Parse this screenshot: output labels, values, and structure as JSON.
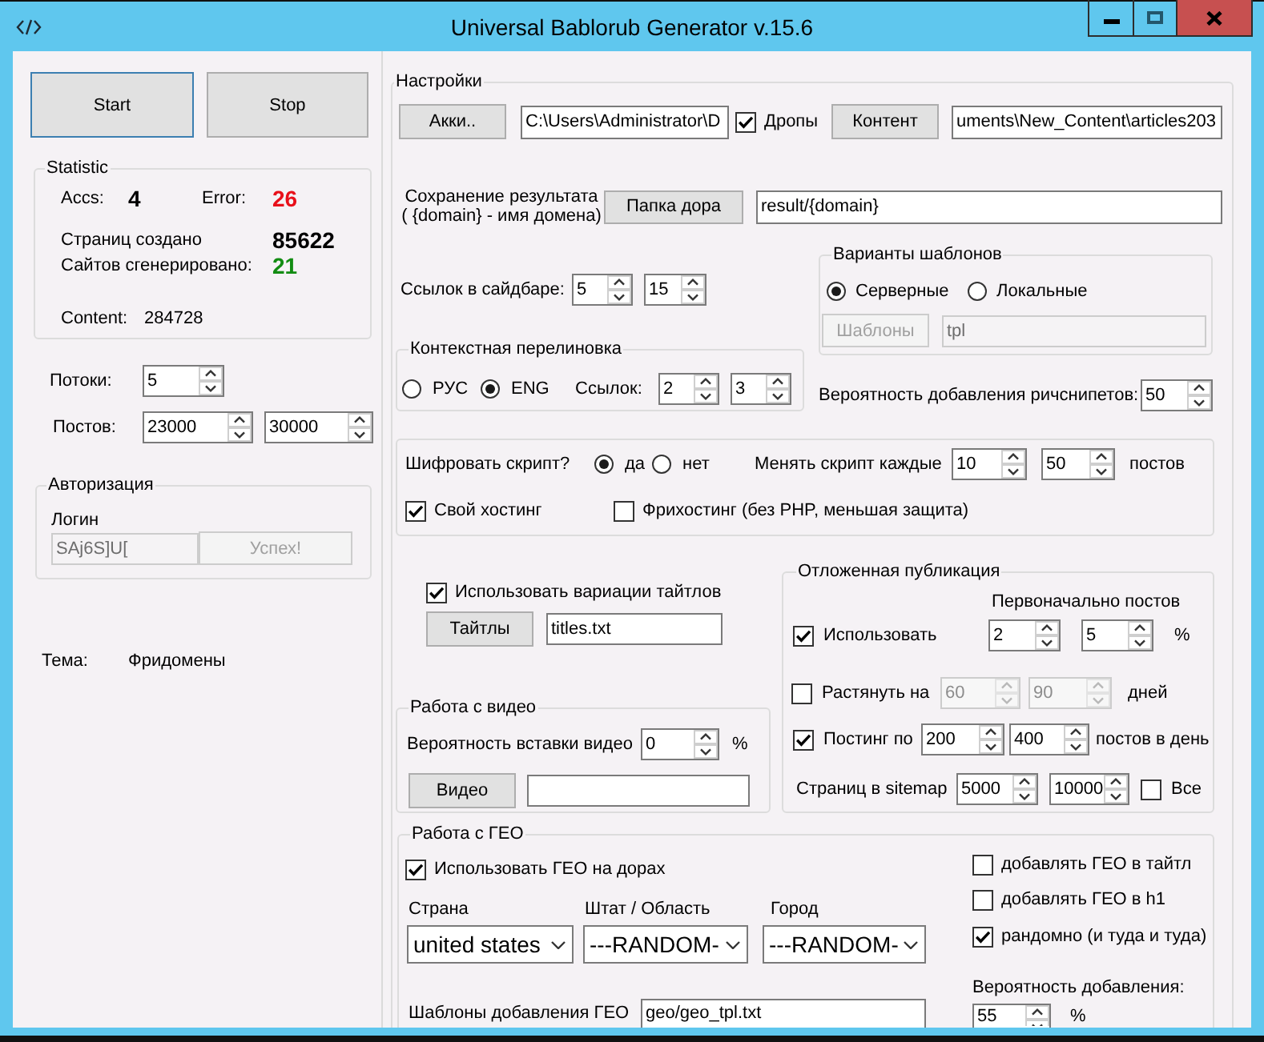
{
  "window": {
    "title": "Universal Bablorub Generator v.15.6"
  },
  "actions": [
    {
      "label": "Start",
      "focused": true
    },
    {
      "label": "Stop",
      "focused": false
    }
  ],
  "statistic": {
    "title": "Statistic",
    "accs": {
      "label": "Accs:",
      "value": "4"
    },
    "errors": {
      "label": "Error:",
      "value": "26"
    },
    "pages": {
      "label": "Страниц создано",
      "value": "85622"
    },
    "sites": {
      "label": "Сайтов сгенерировано:",
      "value": "21"
    },
    "content": {
      "label": "Content:",
      "value": "284728"
    }
  },
  "threads": {
    "label": "Потоки:",
    "value": "5"
  },
  "posts": {
    "label": "Постов:",
    "from": "23000",
    "to": "30000"
  },
  "authorization": {
    "title": "Авторизация",
    "login_label": "Логин",
    "login": {
      "value": "SAj6S]U[",
      "disabled": true
    },
    "button": {
      "label": "Успех!",
      "disabled": true
    }
  },
  "theme": {
    "label": "Тема:",
    "value": "Фридомены"
  },
  "settings": {
    "title": "Настройки",
    "accounts": {
      "button": "Акки..",
      "path": "C:\\Users\\Administrator\\D"
    },
    "drops": {
      "label": "Дропы",
      "checked": true
    },
    "content": {
      "button": "Контент",
      "path": "uments\\New_Content\\articles203"
    },
    "output": {
      "label": [
        "Сохранение результата",
        "( {domain} - имя домена)"
      ],
      "button": "Папка дора",
      "path": "result/{domain}"
    },
    "sidebar_links": {
      "label": "Ссылок в сайдбаре:",
      "from": "5",
      "to": "15"
    },
    "templates": {
      "title": "Варианты шаблонов",
      "options": [
        {
          "label": "Серверные",
          "selected": true
        },
        {
          "label": "Локальные",
          "selected": false
        }
      ],
      "button": "Шаблоны",
      "path": "tpl",
      "disabled": true
    },
    "crosslinking": {
      "title": "Контекстная перелиновка",
      "languages": [
        {
          "label": "РУС",
          "selected": false
        },
        {
          "label": "ENG",
          "selected": true
        }
      ],
      "links_label": "Ссылок:",
      "from": "2",
      "to": "3"
    },
    "rich_snippets": {
      "label": "Вероятность добавления ричснипетов:",
      "value": "50"
    },
    "encryption": {
      "label": "Шифровать скрипт?",
      "options": [
        {
          "label": "да",
          "selected": true
        },
        {
          "label": "нет",
          "selected": false
        }
      ],
      "rotate_label": "Менять скрипт каждые",
      "from": "10",
      "to": "50",
      "unit": "постов",
      "hosting": [
        {
          "label": "Свой хостинг",
          "checked": true
        },
        {
          "label": "Фрихостинг (без PHP, меньшая защита)",
          "checked": false
        }
      ]
    },
    "titles": {
      "label": "Использовать вариации тайтлов",
      "checked": true,
      "button": "Тайтлы",
      "path": "titles.txt"
    },
    "video": {
      "title": "Работа с видео",
      "label": "Вероятность вставки видео",
      "value": "0",
      "unit": "%",
      "button": "Видео"
    },
    "delayed": {
      "title": "Отложенная публикация",
      "header": "Первоначально постов",
      "rows": [
        {
          "kind": "checkbox",
          "label": "Использовать",
          "checked": true,
          "from": "2",
          "to": "5",
          "unit": "%",
          "disabled": false
        },
        {
          "kind": "checkbox",
          "label": "Растянуть на",
          "checked": false,
          "from": "60",
          "to": "90",
          "unit": "дней",
          "disabled": true
        },
        {
          "kind": "checkbox",
          "label": "Постинг по",
          "checked": true,
          "from": "200",
          "to": "400",
          "unit": "постов в день",
          "disabled": false
        },
        {
          "kind": "label",
          "label": "Страниц в sitemap",
          "from": "5000",
          "to": "10000",
          "disabled": false,
          "all": {
            "label": "Все",
            "checked": false
          }
        }
      ]
    },
    "geo": {
      "title": "Работа с ГЕО",
      "use": {
        "label": "Использовать ГЕО на дорах",
        "checked": true
      },
      "selects": [
        {
          "label": "Страна",
          "value": "united states"
        },
        {
          "label": "Штат / Область",
          "value": "---RANDOM-"
        },
        {
          "label": "Город",
          "value": "---RANDOM-"
        }
      ],
      "templates_label": "Шаблоны добавления ГЕО",
      "templates_path": "geo/geo_tpl.txt",
      "options": [
        {
          "label": "добавлять ГЕО в тайтл",
          "checked": false
        },
        {
          "label": "добавлять ГЕО в h1",
          "checked": false
        },
        {
          "label": "рандомно (и туда и туда)",
          "checked": true
        }
      ],
      "probability_label": "Вероятность добавления:",
      "probability": "55",
      "unit": "%"
    }
  }
}
